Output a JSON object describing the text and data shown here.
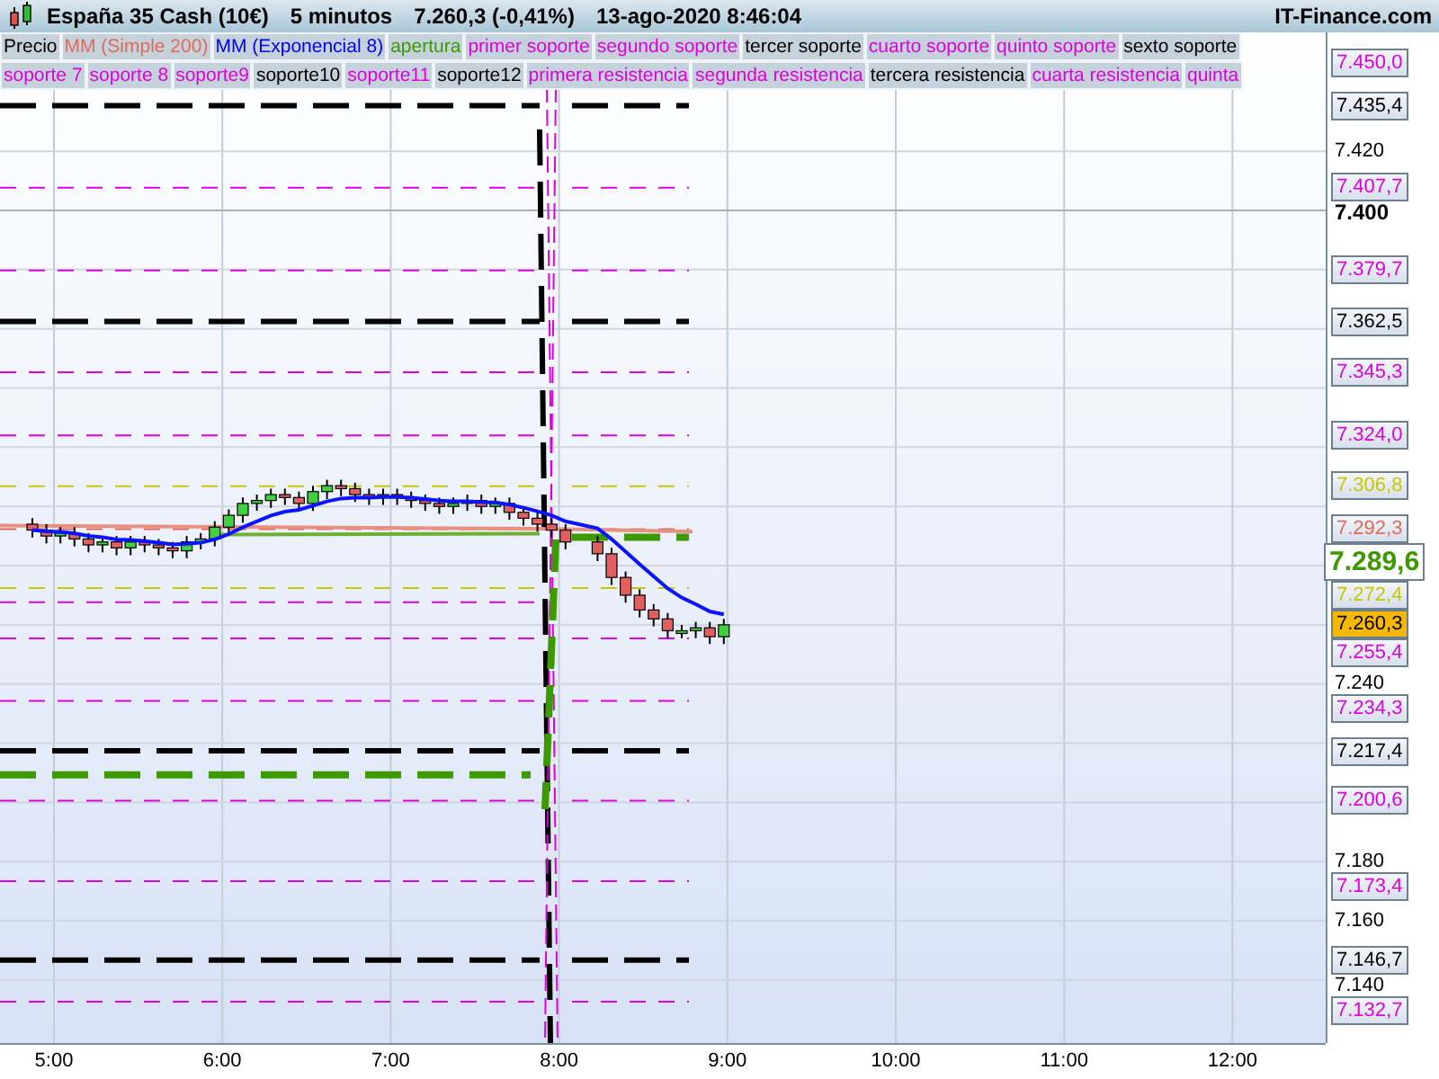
{
  "header": {
    "instrument": "España 35 Cash (10€)",
    "timeframe": "5 minutos",
    "quote": "7.260,3 (-0,41%)",
    "datetime": "13-ago-2020 8:46:04",
    "site": "IT-Finance.com"
  },
  "legend_rows": [
    [
      {
        "label": "Precio",
        "color": "#000000"
      },
      {
        "label": "MM (Simple 200)",
        "color": "#e06a5a"
      },
      {
        "label": "MM (Exponencial 8)",
        "color": "#0000ff"
      },
      {
        "label": "apertura",
        "color": "#3c9a00"
      },
      {
        "label": "primer soporte",
        "color": "#dd00dd"
      },
      {
        "label": "segundo soporte",
        "color": "#dd00dd"
      },
      {
        "label": "tercer soporte",
        "color": "#000000"
      },
      {
        "label": "cuarto soporte",
        "color": "#dd00dd"
      },
      {
        "label": "quinto soporte",
        "color": "#dd00dd"
      },
      {
        "label": "sexto soporte",
        "color": "#000000"
      }
    ],
    [
      {
        "label": "soporte 7",
        "color": "#dd00dd"
      },
      {
        "label": "soporte 8",
        "color": "#dd00dd"
      },
      {
        "label": "soporte9",
        "color": "#dd00dd"
      },
      {
        "label": "soporte10",
        "color": "#000000"
      },
      {
        "label": "soporte11",
        "color": "#dd00dd"
      },
      {
        "label": "soporte12",
        "color": "#000000"
      },
      {
        "label": "primera resistencia",
        "color": "#dd00dd"
      },
      {
        "label": "segunda resistencia",
        "color": "#dd00dd"
      },
      {
        "label": "tercera resistencia",
        "color": "#000000"
      },
      {
        "label": "cuarta resistencia",
        "color": "#dd00dd"
      },
      {
        "label": "quinta",
        "color": "#dd00dd"
      }
    ]
  ],
  "price_axis": {
    "ticks": [
      {
        "label": "7.420",
        "bold": false
      },
      {
        "label": "7.400",
        "bold": true
      },
      {
        "label": "7.240",
        "bold": false
      },
      {
        "label": "7.180",
        "bold": false
      },
      {
        "label": "7.160",
        "bold": false
      },
      {
        "label": "7.140",
        "bold": false
      }
    ],
    "price_labels": [
      {
        "label": "7.450,0",
        "color": "#dd00dd",
        "kind": "box"
      },
      {
        "label": "7.435,4",
        "color": "#000000",
        "kind": "box"
      },
      {
        "label": "7.407,7",
        "color": "#dd00dd",
        "kind": "box"
      },
      {
        "label": "7.379,7",
        "color": "#dd00dd",
        "kind": "box"
      },
      {
        "label": "7.362,5",
        "color": "#000000",
        "kind": "box"
      },
      {
        "label": "7.345,3",
        "color": "#dd00dd",
        "kind": "box"
      },
      {
        "label": "7.324,0",
        "color": "#dd00dd",
        "kind": "box"
      },
      {
        "label": "7.306,8",
        "color": "#c8c800",
        "kind": "box"
      },
      {
        "label": "7.292,3",
        "color": "#e06a5a",
        "kind": "box"
      },
      {
        "label": "7.289,6",
        "color": "#3c9a00",
        "kind": "large"
      },
      {
        "label": "7.272,4",
        "color": "#c8c800",
        "kind": "box"
      },
      {
        "label": "7.260,3",
        "color": "#f5b800",
        "kind": "current"
      },
      {
        "label": "7.255,4",
        "color": "#dd00dd",
        "kind": "box"
      },
      {
        "label": "7.234,3",
        "color": "#dd00dd",
        "kind": "box"
      },
      {
        "label": "7.217,4",
        "color": "#000000",
        "kind": "box"
      },
      {
        "label": "7.200,6",
        "color": "#dd00dd",
        "kind": "box"
      },
      {
        "label": "7.173,4",
        "color": "#dd00dd",
        "kind": "box"
      },
      {
        "label": "7.146,7",
        "color": "#000000",
        "kind": "box"
      },
      {
        "label": "7.132,7",
        "color": "#dd00dd",
        "kind": "box"
      }
    ]
  },
  "time_axis": [
    "5:00",
    "6:00",
    "7:00",
    "8:00",
    "9:00",
    "10:00",
    "11:00",
    "12:00"
  ]
}
